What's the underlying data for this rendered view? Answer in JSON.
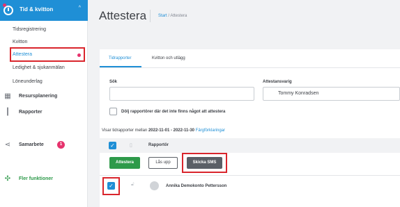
{
  "sidebar": {
    "section_title": "Tid & kvitton",
    "sub_items": [
      "Tidsregistrering",
      "Kvitton",
      "Attestera",
      "Ledighet & sjukanmälan",
      "Löneunderlag"
    ],
    "main_items": [
      {
        "label": "Resursplanering",
        "icon": "calendar-icon"
      },
      {
        "label": "Rapporter",
        "icon": "bar-chart-icon"
      },
      {
        "label": "Samarbete",
        "icon": "share-icon",
        "badge": "1"
      },
      {
        "label": "Fler funktioner",
        "icon": "puzzle-icon"
      }
    ]
  },
  "header": {
    "title": "Attestera",
    "breadcrumb_home": "Start",
    "breadcrumb_sep": " / ",
    "breadcrumb_current": "Attestera"
  },
  "tabs": [
    "Tidrapporter",
    "Kvitton och utlägg"
  ],
  "filters": {
    "search_label": "Sök",
    "search_value": "",
    "approver_label": "Attestansvarig",
    "approver_value": "Tommy Konradsen",
    "hide_checkbox_label": "Dölj rapportörer där det inte finns något att attestera"
  },
  "range": {
    "prefix": "Visar tidrapporter mellan",
    "dates": "2022-11-01 - 2022-11-30",
    "legend_link": "Färgförklaringar"
  },
  "table": {
    "column_reporter": "Rapportör",
    "rows": [
      {
        "name": "Annika Demokonto Pettersson",
        "checked": true
      }
    ]
  },
  "actions": {
    "approve": "Attestera",
    "unlock": "Lås upp",
    "send_sms": "Skicka SMS"
  },
  "colors": {
    "accent": "#1f8fd6",
    "highlight": "#d9252c",
    "approve": "#2e9a4a",
    "sms": "#5a5f66",
    "badge": "#e6336d"
  }
}
